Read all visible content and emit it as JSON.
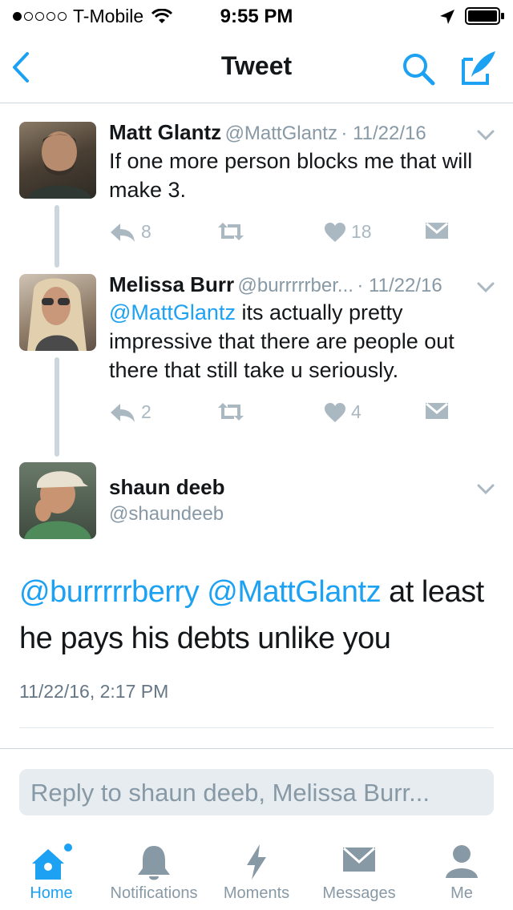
{
  "status_bar": {
    "carrier": "T-Mobile",
    "time": "9:55 PM"
  },
  "nav": {
    "title": "Tweet"
  },
  "tweets": [
    {
      "name": "Matt Glantz",
      "handle": "@MattGlantz",
      "date": "· 11/22/16",
      "text": "If one more person blocks me that will make 3.",
      "reply_count": "8",
      "like_count": "18"
    },
    {
      "name": "Melissa Burr",
      "handle": "@burrrrrber...",
      "date": "· 11/22/16",
      "mention": "@MattGlantz",
      "text": " its actually pretty impressive that there are people out there that still take u seriously.",
      "reply_count": "2",
      "like_count": "4"
    }
  ],
  "main_tweet": {
    "name": "shaun deeb",
    "handle": "@shaundeeb",
    "mention1": "@burrrrrberry",
    "mention2": "@MattGlantz",
    "text": " at least he pays his debts unlike you",
    "timestamp": "11/22/16, 2:17 PM"
  },
  "reply_placeholder": "Reply to shaun deeb, Melissa Burr...",
  "tabs": [
    {
      "label": "Home",
      "icon": "home-icon",
      "active": true
    },
    {
      "label": "Notifications",
      "icon": "bell-icon"
    },
    {
      "label": "Moments",
      "icon": "lightning-icon"
    },
    {
      "label": "Messages",
      "icon": "envelope-icon"
    },
    {
      "label": "Me",
      "icon": "person-icon"
    }
  ],
  "colors": {
    "accent": "#1da1f2",
    "text": "#14171a",
    "muted": "#8899a6"
  }
}
